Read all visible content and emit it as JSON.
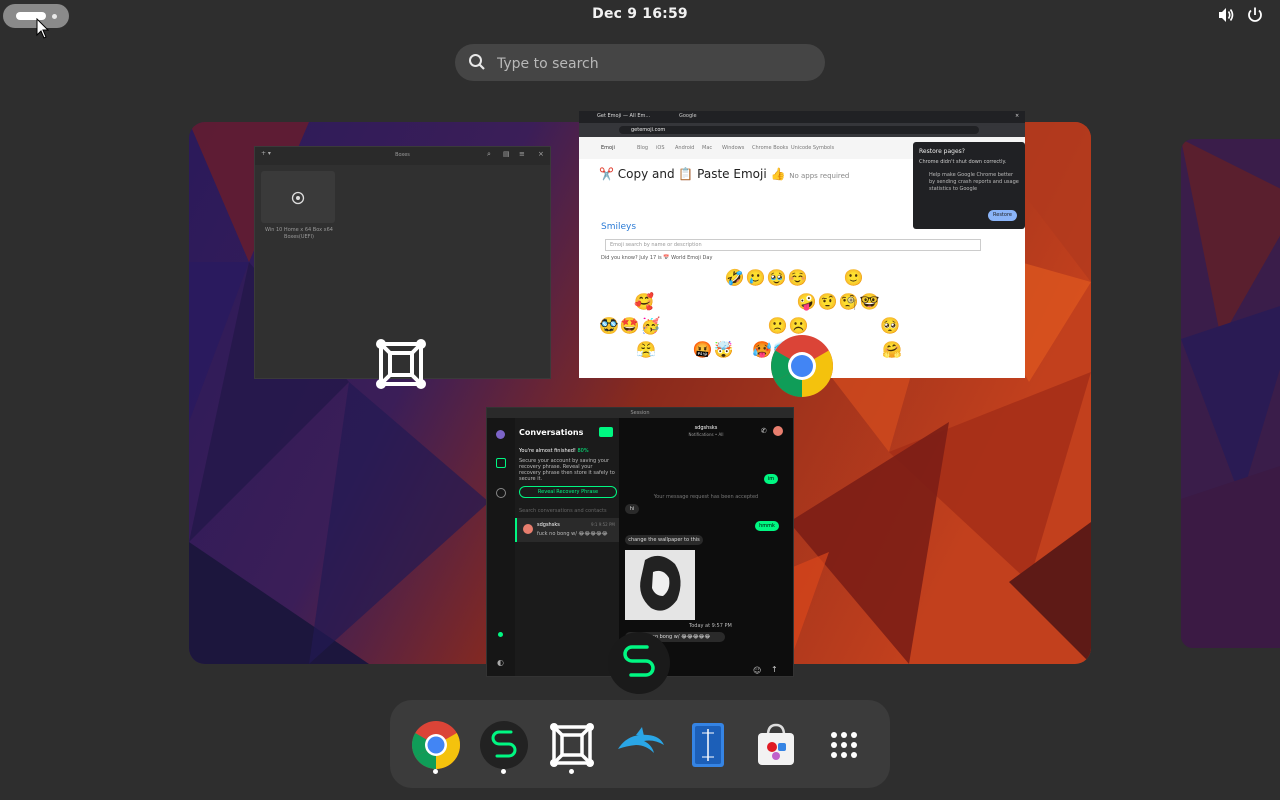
{
  "topbar": {
    "clock": "Dec 9  16:59",
    "activities_label": "Activities",
    "icons": [
      "volume-icon",
      "power-icon"
    ]
  },
  "search": {
    "placeholder": "Type to search"
  },
  "windows": {
    "files": {
      "title": "Boxes",
      "item_caption": "Win 10 Home x 64 Box x64 Boxes(UEFI)"
    },
    "chrome": {
      "tab1": "Get Emoji — All Em...",
      "tab2": "Google",
      "url": "getemoji.com",
      "nav": [
        "Emoji",
        "Blog",
        "iOS",
        "Android",
        "Mac",
        "Windows",
        "Chrome Books",
        "Unicode Symbols"
      ],
      "heading": "Copy and 📋 Paste Emoji 👍",
      "heading_note": "No apps required",
      "section": "Smileys",
      "search_placeholder": "Emoji search by name or description",
      "did_you_know": "Did you know? July 17 is 📅 World Emoji Day",
      "restore_title": "Restore pages?",
      "restore_body": "Chrome didn't shut down correctly.",
      "restore_check": "Help make Google Chrome better by sending crash reports and usage statistics to Google",
      "restore_button": "Restore",
      "emoji_rows": [
        "😀😃😄😁😆😅😂🤣🥲🥹☺️😊😇🙂🙃😉",
        "😌😍🥰😘😗😙😚😋😛😝😜🤪🤨🧐🤓😎",
        "🥸🤩🥳😏😒😞😔😟😕🙁☹️😣😖😫😩🥺",
        "😢😭😤😠😡🤬🤯😳🥵🥶😱😨😰😥😓🤗"
      ]
    },
    "session": {
      "title": "Session",
      "conversations": "Conversations",
      "almost": "You're almost finished!",
      "almost_pct": "80%",
      "almost_body": "Secure your account by saving your recovery phrase. Reveal your recovery phrase then store it safely to secure it.",
      "reveal": "Reveal Recovery Phrase",
      "search_ph": "Search conversations and contacts",
      "contact_name": "sdgshsks",
      "contact_preview": "fuck no bong w/ 😂😂😂😂😂",
      "contact_time": "9:1 9:52 PM",
      "header_name": "sdgshsks",
      "header_sub": "Notifications • All",
      "msg_request": "Your message request has been accepted",
      "bubbles": [
        "im",
        "hi",
        "hmmk",
        "change the wallpaper to this",
        "Today at 9:57 PM",
        "fuck no bong w/ 😂😂😂😂😂"
      ]
    }
  },
  "dash": {
    "apps": [
      "Google Chrome",
      "Session",
      "Boxes",
      "Dolphin",
      "Text Editor",
      "Software",
      "Show Apps"
    ]
  },
  "colors": {
    "chrome_red": "#db4437",
    "chrome_yellow": "#f4c20d",
    "chrome_green": "#0f9d58",
    "chrome_blue": "#4285f4",
    "session_green": "#00f782",
    "dolphin_blue": "#2aa6e6",
    "editor_blue": "#3584e4"
  }
}
